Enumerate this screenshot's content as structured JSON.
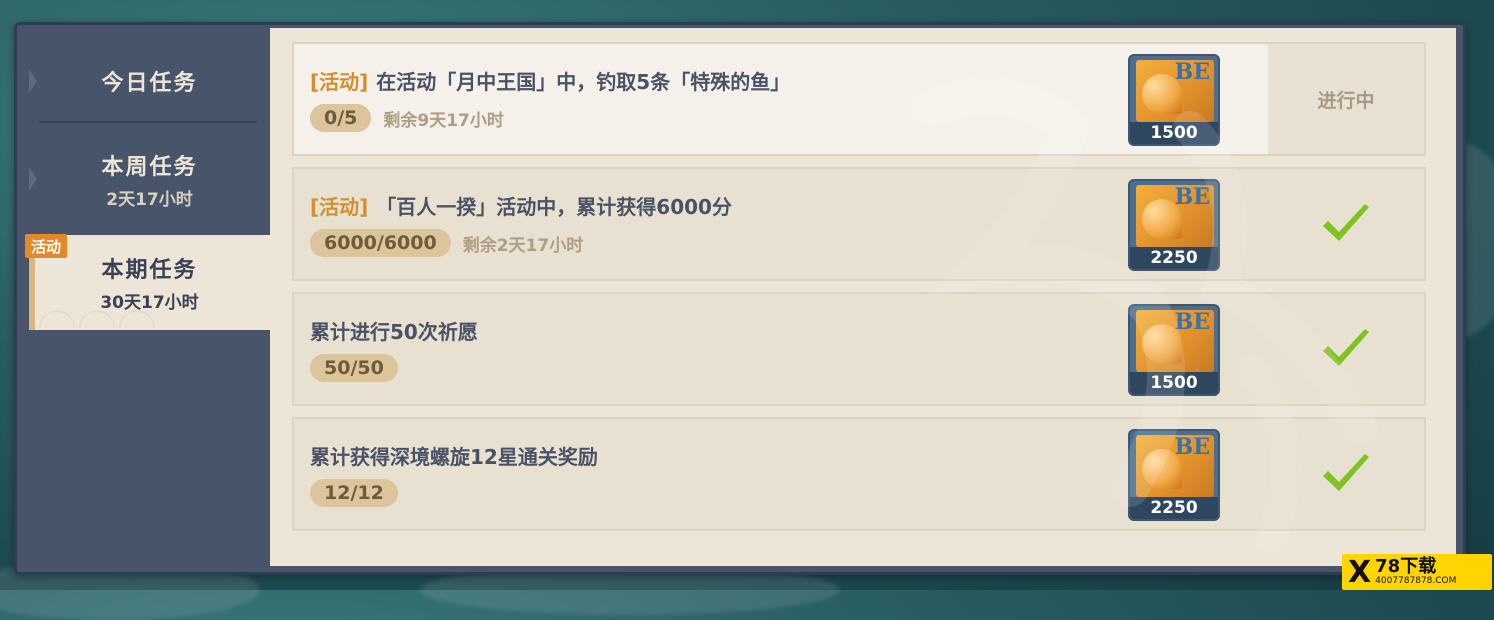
{
  "sidebar": {
    "items": [
      {
        "label": "今日任务",
        "sub": ""
      },
      {
        "label": "本周任务",
        "sub": "2天17小时"
      },
      {
        "label": "本期任务",
        "sub": "30天17小时"
      }
    ],
    "activity_tag": "活动"
  },
  "tasks": [
    {
      "tag": "[活动]",
      "title": "在活动「月中王国」中，钓取5条「特殊的鱼」",
      "progress": "0/5",
      "remaining": "剩余9天17小时",
      "reward_amount": "1500",
      "status": "进行中"
    },
    {
      "tag": "[活动]",
      "title": "「百人一揆」活动中，累计获得6000分",
      "progress": "6000/6000",
      "remaining": "剩余2天17小时",
      "reward_amount": "2250",
      "status": "completed"
    },
    {
      "tag": "",
      "title": "累计进行50次祈愿",
      "progress": "50/50",
      "remaining": "",
      "reward_amount": "1500",
      "status": "completed"
    },
    {
      "tag": "",
      "title": "累计获得深境螺旋12星通关奖励",
      "progress": "12/12",
      "remaining": "",
      "reward_amount": "2250",
      "status": "completed"
    }
  ],
  "reward_icon_letters": "BE",
  "logo": {
    "mark": "X",
    "name": "78下载",
    "url": "4007787878.COM"
  },
  "colors": {
    "accent": "#d38f2d",
    "check": "#7ec322",
    "panel": "#ece5d8",
    "sidebar": "#47546a"
  }
}
